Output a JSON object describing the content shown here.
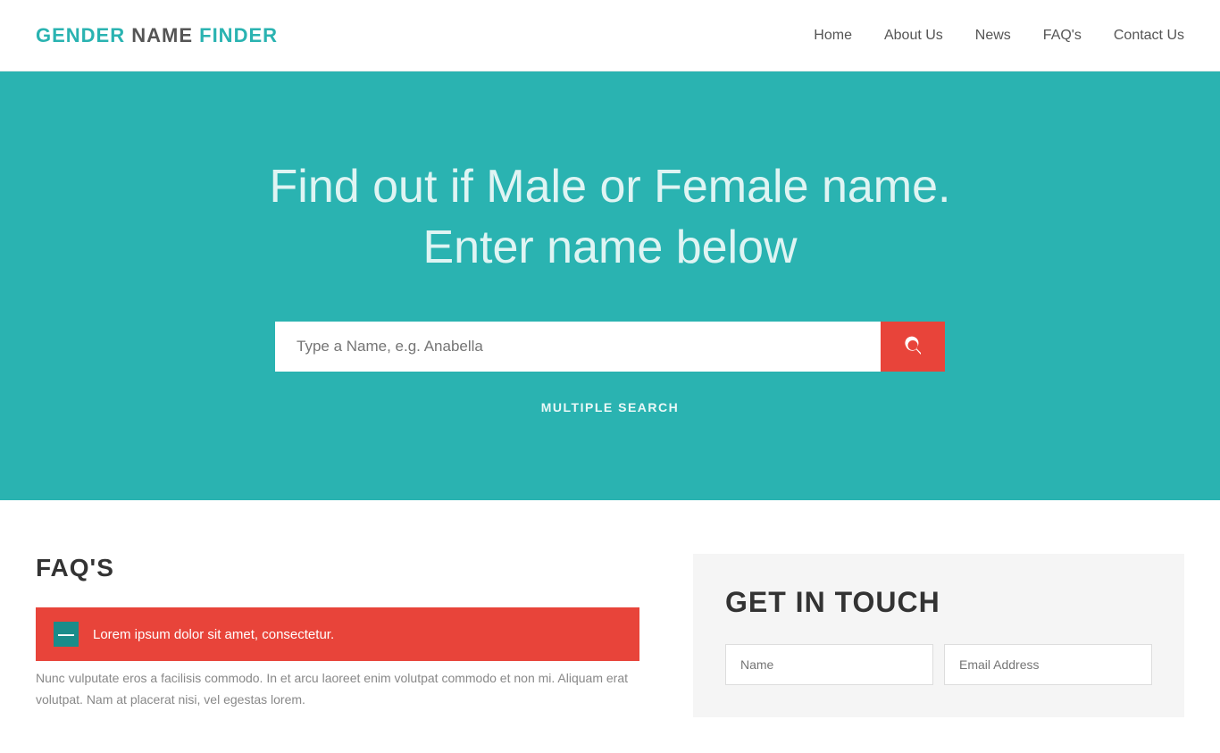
{
  "navbar": {
    "brand": {
      "gender": "GENDER",
      "name": " NAME ",
      "finder": "FINDER"
    },
    "links": [
      {
        "id": "home",
        "label": "Home"
      },
      {
        "id": "about-us",
        "label": "About Us"
      },
      {
        "id": "news",
        "label": "News"
      },
      {
        "id": "faqs",
        "label": "FAQ's"
      },
      {
        "id": "contact-us",
        "label": "Contact Us"
      }
    ]
  },
  "hero": {
    "title_line1": "Find out if Male or Female name.",
    "title_line2": "Enter name below",
    "search_placeholder": "Type a Name, e.g. Anabella",
    "multiple_search_label": "MULTIPLE SEARCH"
  },
  "faq": {
    "section_title": "FAQ'S",
    "accordion_item": {
      "toggle": "—",
      "question": "Lorem ipsum dolor sit amet, consectetur."
    },
    "body_text": "Nunc vulputate eros a facilisis commodo. In et arcu laoreet enim volutpat commodo et non mi. Aliquam erat volutpat. Nam at placerat nisi, vel egestas lorem."
  },
  "contact": {
    "section_title": "GET IN TOUCH",
    "name_placeholder": "Name",
    "email_placeholder": "Email Address"
  },
  "colors": {
    "teal": "#2ab3b1",
    "red": "#e8443a",
    "dark_teal": "#1a8c8a"
  }
}
